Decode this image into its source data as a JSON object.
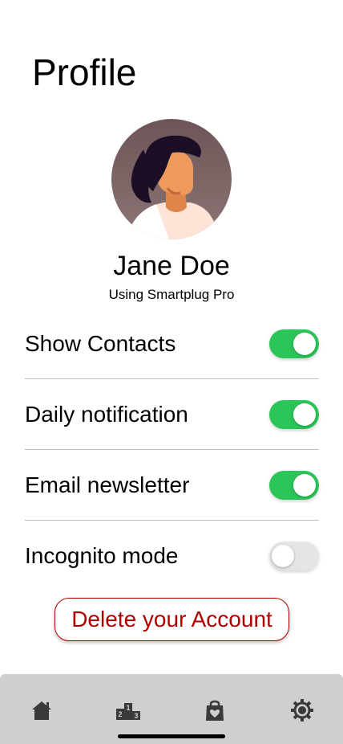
{
  "header": {
    "title": "Profile"
  },
  "user": {
    "name": "Jane Doe",
    "subtitle": "Using Smartplug Pro"
  },
  "settings": [
    {
      "label": "Show Contacts",
      "enabled": true
    },
    {
      "label": "Daily notification",
      "enabled": true
    },
    {
      "label": "Email newsletter",
      "enabled": true
    },
    {
      "label": "Incognito mode",
      "enabled": false
    }
  ],
  "actions": {
    "delete_label": "Delete your Account"
  },
  "tabbar": {
    "items": [
      {
        "icon": "home-icon"
      },
      {
        "icon": "leaderboard-icon"
      },
      {
        "icon": "favorites-bag-icon"
      },
      {
        "icon": "settings-gear-icon"
      }
    ],
    "leaderboard_numbers": [
      "2",
      "1",
      "3"
    ]
  },
  "colors": {
    "toggle_on": "#2cc55a",
    "toggle_off": "#e5e5e5",
    "danger": "#b10000",
    "tabbar_bg": "#cfcfcf",
    "icon": "#3a3a3a"
  }
}
